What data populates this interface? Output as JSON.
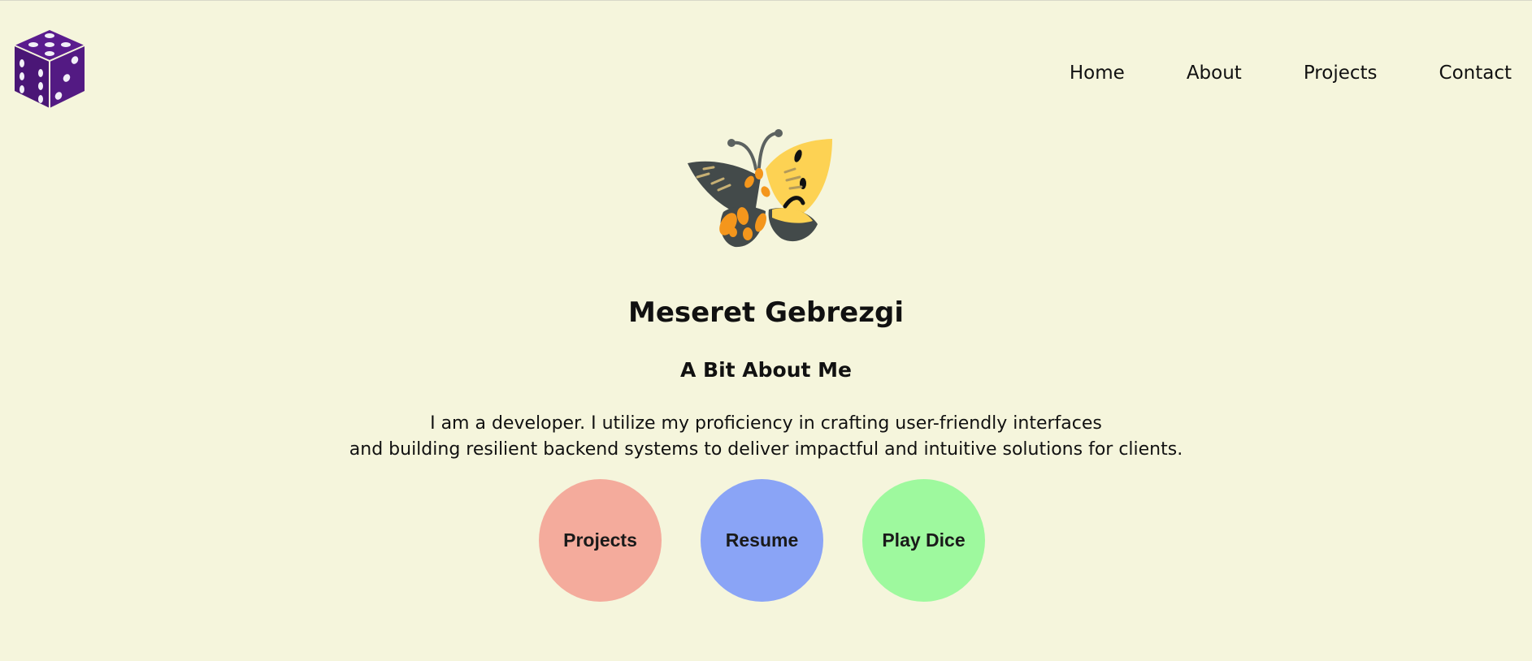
{
  "header": {
    "logo_icon": "purple-dice-icon",
    "nav": [
      {
        "label": "Home"
      },
      {
        "label": "About"
      },
      {
        "label": "Projects"
      },
      {
        "label": "Contact"
      }
    ]
  },
  "hero": {
    "illustration_icon": "butterfly-icon",
    "name": "Meseret Gebrezgi",
    "subtitle": "A Bit About Me",
    "bio_line1": "I am a developer. I utilize my proficiency in crafting user-friendly interfaces",
    "bio_line2": "and building resilient backend systems to deliver impactful and intuitive solutions for clients."
  },
  "actions": [
    {
      "label": "Projects",
      "color": "#f4ab9c"
    },
    {
      "label": "Resume",
      "color": "#8aa4f6"
    },
    {
      "label": "Play Dice",
      "color": "#9ef99e"
    }
  ],
  "colors": {
    "background": "#f5f5dc",
    "dice": "#5a1c8e"
  }
}
